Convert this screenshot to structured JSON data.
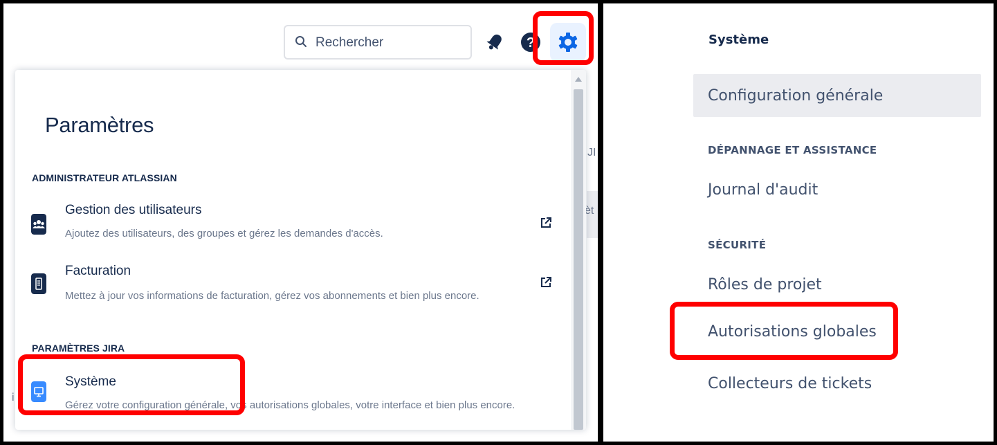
{
  "header": {
    "search": {
      "placeholder": "Rechercher"
    }
  },
  "settings_menu": {
    "title": "Paramètres",
    "sections": [
      {
        "header": "ADMINISTRATEUR ATLASSIAN",
        "items": [
          {
            "title": "Gestion des utilisateurs",
            "description": "Ajoutez des utilisateurs, des groupes et gérez les demandes d'accès.",
            "icon": "users-icon",
            "external": true
          },
          {
            "title": "Facturation",
            "description": "Mettez à jour vos informations de facturation, gérez vos abonnements et bien plus encore.",
            "icon": "billing-icon",
            "external": true
          }
        ]
      },
      {
        "header": "PARAMÈTRES JIRA",
        "items": [
          {
            "title": "Système",
            "description": "Gérez votre configuration générale, vos autorisations globales, votre interface et bien plus encore.",
            "icon": "system-icon",
            "external": false
          }
        ]
      }
    ],
    "background_peek": [
      "JI",
      "èt",
      "i"
    ]
  },
  "system_sidebar": {
    "title": "Système",
    "selected": "Configuration générale",
    "sections": [
      {
        "header": "DÉPANNAGE ET ASSISTANCE",
        "items": [
          "Journal d'audit"
        ]
      },
      {
        "header": "SÉCURITÉ",
        "items": [
          "Rôles de projet",
          "Autorisations globales",
          "Collecteurs de tickets"
        ]
      }
    ]
  },
  "colors": {
    "highlight": "#ff0000",
    "accent": "#0c66e4",
    "system_icon": "#388bff",
    "dark_icon": "#172b4d"
  }
}
